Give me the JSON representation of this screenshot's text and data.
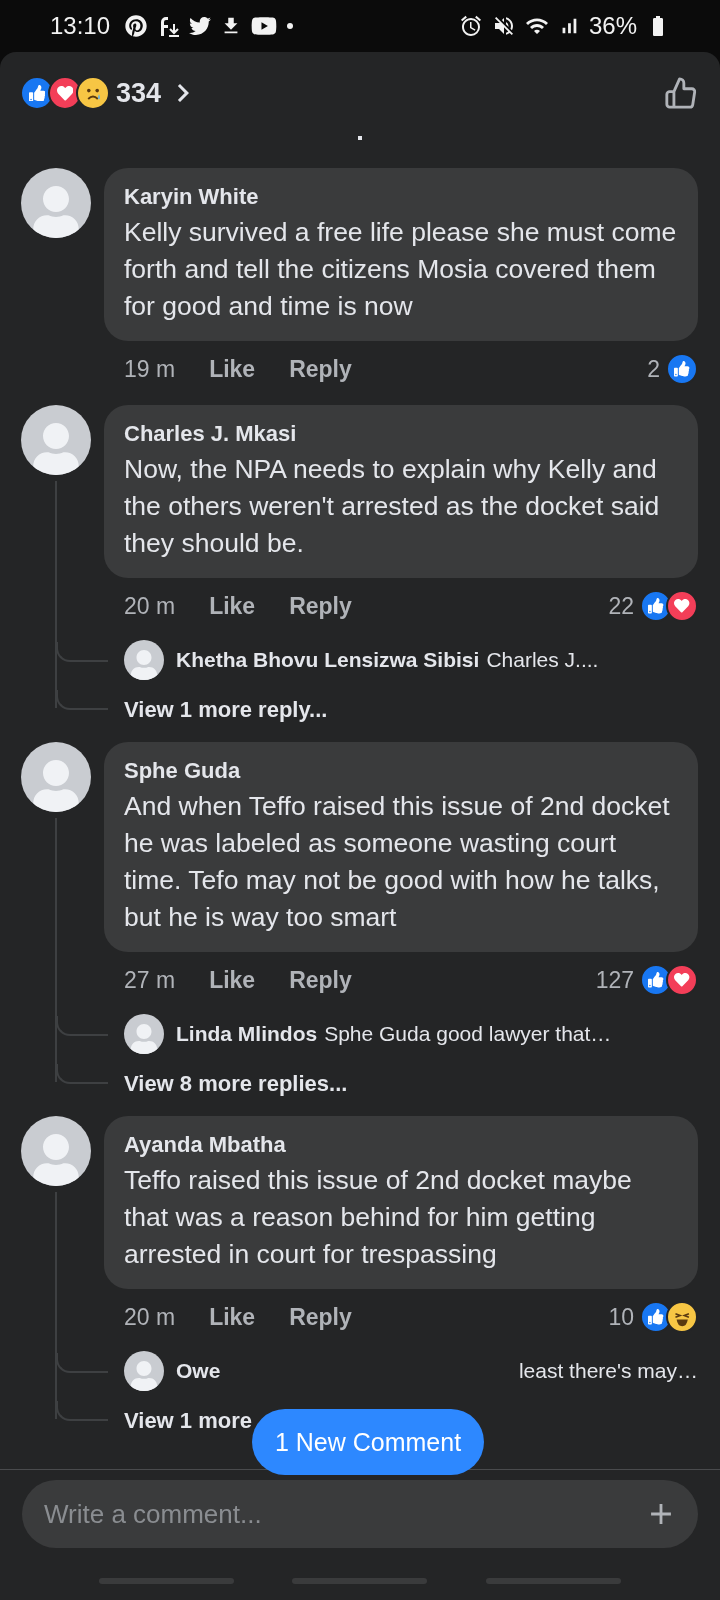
{
  "status_bar": {
    "time": "13:10",
    "battery": "36%"
  },
  "header": {
    "reactions": [
      {
        "kind": "like"
      },
      {
        "kind": "love"
      },
      {
        "kind": "sad"
      }
    ],
    "count": "334"
  },
  "comments": [
    {
      "name": "Karyin White",
      "text": "Kelly survived a free life please she must come forth and tell the citizens Mosia covered them for good and time is now",
      "time": "19 m",
      "like": "Like",
      "reply": "Reply",
      "reaction_count": "2",
      "reactions": [
        {
          "kind": "like"
        }
      ]
    },
    {
      "name": "Charles J. Mkasi",
      "text": "Now, the NPA needs to explain why Kelly and the others weren't arrested as the docket said they should be.",
      "time": "20 m",
      "like": "Like",
      "reply": "Reply",
      "reaction_count": "22",
      "reactions": [
        {
          "kind": "like"
        },
        {
          "kind": "love"
        }
      ],
      "replies": [
        {
          "name": "Khetha Bhovu Lensizwa Sibisi",
          "text": "Charles J...."
        }
      ],
      "more": "View 1 more reply..."
    },
    {
      "name": "Sphe Guda",
      "text": "And when Teffo raised this issue of 2nd docket  he was labeled as someone wasting court time. Tefo may not be good with how he talks, but he is way too smart",
      "time": "27 m",
      "like": "Like",
      "reply": "Reply",
      "reaction_count": "127",
      "reactions": [
        {
          "kind": "like"
        },
        {
          "kind": "love"
        }
      ],
      "replies": [
        {
          "name": "Linda Mlindos",
          "text": "Sphe Guda good lawyer that…"
        }
      ],
      "more": "View 8 more replies..."
    },
    {
      "name": "Ayanda Mbatha",
      "text": "Teffo raised this issue of 2nd docket maybe that was a reason behind for him getting arrested in court for trespassing",
      "time": "20 m",
      "like": "Like",
      "reply": "Reply",
      "reaction_count": "10",
      "reactions": [
        {
          "kind": "like"
        },
        {
          "kind": "haha"
        }
      ],
      "replies": [
        {
          "name": "Owe",
          "text": "least there's may…",
          "covered": true
        }
      ],
      "more": "View 1 more"
    }
  ],
  "new_comment_button": "1 New Comment",
  "composer": {
    "placeholder": "Write a comment..."
  }
}
